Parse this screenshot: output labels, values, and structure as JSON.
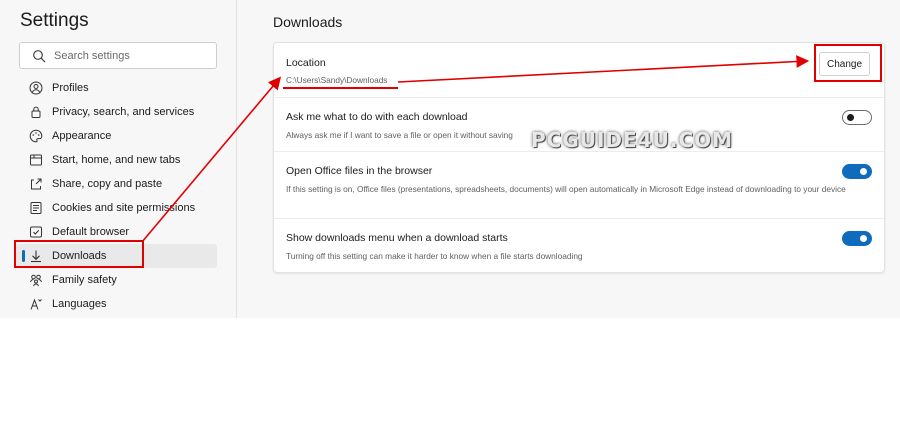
{
  "sidebar": {
    "title": "Settings",
    "search_placeholder": "Search settings",
    "items": [
      {
        "label": "Profiles",
        "icon": "profile-icon"
      },
      {
        "label": "Privacy, search, and services",
        "icon": "lock-icon"
      },
      {
        "label": "Appearance",
        "icon": "appearance-icon"
      },
      {
        "label": "Start, home, and new tabs",
        "icon": "home-tabs-icon"
      },
      {
        "label": "Share, copy and paste",
        "icon": "share-icon"
      },
      {
        "label": "Cookies and site permissions",
        "icon": "cookies-icon"
      },
      {
        "label": "Default browser",
        "icon": "browser-icon"
      },
      {
        "label": "Downloads",
        "icon": "download-icon",
        "active": true
      },
      {
        "label": "Family safety",
        "icon": "family-icon"
      },
      {
        "label": "Languages",
        "icon": "languages-icon"
      }
    ]
  },
  "main": {
    "title": "Downloads",
    "location": {
      "label": "Location",
      "path": "C:\\Users\\Sandy\\Downloads",
      "button": "Change"
    },
    "ask": {
      "label": "Ask me what to do with each download",
      "desc": "Always ask me if I want to save a file or open it without saving",
      "enabled": false
    },
    "office": {
      "label": "Open Office files in the browser",
      "desc": "If this setting is on, Office files (presentations, spreadsheets, documents) will open automatically in Microsoft Edge instead of downloading to your device",
      "enabled": true
    },
    "menu": {
      "label": "Show downloads menu when a download starts",
      "desc": "Turning off this setting can make it harder to know when a file starts downloading",
      "enabled": true
    }
  },
  "watermark": "PCGUIDE4U.COM",
  "colors": {
    "accent": "#0f6cbd",
    "annotation": "#e00000"
  }
}
